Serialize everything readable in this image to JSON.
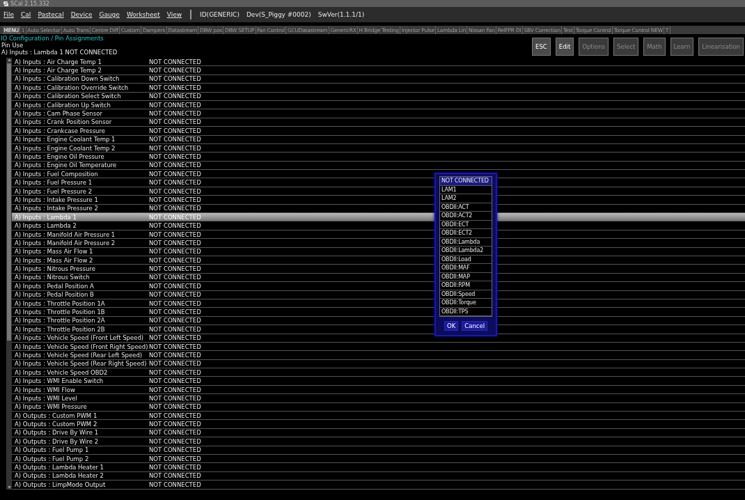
{
  "window": {
    "title": "SCal 2.15.332"
  },
  "menu": [
    {
      "label": "File"
    },
    {
      "label": "Cal"
    },
    {
      "label": "Pastecal"
    },
    {
      "label": "Device"
    },
    {
      "label": "Gauge"
    },
    {
      "label": "Worksheet"
    },
    {
      "label": "View"
    }
  ],
  "device_info": [
    "ID(GENERIC)",
    "Dev(S_Piggy #0002)",
    "SwVer(1.1.1/1)"
  ],
  "tabs": [
    {
      "label": "MENU",
      "selected": true
    },
    {
      "label": "1",
      "selected": false
    },
    {
      "label": "Auto Selector",
      "selected": false
    },
    {
      "label": "Auto Trans",
      "selected": false
    },
    {
      "label": "Centre Diff",
      "selected": false
    },
    {
      "label": "Custom",
      "selected": false
    },
    {
      "label": "Dampers",
      "selected": false
    },
    {
      "label": "Datastream",
      "selected": false
    },
    {
      "label": "DBW pos",
      "selected": false
    },
    {
      "label": "DBW SETUP",
      "selected": false
    },
    {
      "label": "Fan Control",
      "selected": false
    },
    {
      "label": "GCUDatastream",
      "selected": false
    },
    {
      "label": "GenericRX",
      "selected": false
    },
    {
      "label": "H Bridge Testing",
      "selected": false
    },
    {
      "label": "Injector Pulse",
      "selected": false
    },
    {
      "label": "Lambda Lin",
      "selected": false
    },
    {
      "label": "Nissan Fan",
      "selected": false
    },
    {
      "label": "RelFPR DI",
      "selected": false
    },
    {
      "label": "SBV Correction",
      "selected": false
    },
    {
      "label": "Test",
      "selected": false
    },
    {
      "label": "Torque Control",
      "selected": false
    },
    {
      "label": "Torque Control NEW",
      "selected": false
    },
    {
      "label": "T",
      "selected": false
    }
  ],
  "page_title": "IO Configuration / Pin Assignments",
  "header": {
    "label": "Pin Use",
    "current": "A) Inputs : Lambda 1  NOT CONNECTED"
  },
  "actions": [
    {
      "label": "ESC",
      "disabled": false
    },
    {
      "label": "Edit",
      "disabled": false
    },
    {
      "label": "Options",
      "disabled": true
    },
    {
      "label": "Select",
      "disabled": true
    },
    {
      "label": "Math",
      "disabled": true
    },
    {
      "label": "Learn",
      "disabled": true
    },
    {
      "label": "Linearisation",
      "disabled": true
    }
  ],
  "rows": [
    {
      "name": "A) Inputs : Air Charge Temp 1",
      "value": "NOT CONNECTED",
      "selected": false
    },
    {
      "name": "A) Inputs : Air Charge Temp 2",
      "value": "NOT CONNECTED",
      "selected": false
    },
    {
      "name": "A) Inputs : Calibration Down Switch",
      "value": "NOT CONNECTED",
      "selected": false
    },
    {
      "name": "A) Inputs : Calibration Override Switch",
      "value": "NOT CONNECTED",
      "selected": false
    },
    {
      "name": "A) Inputs : Calibration Select Switch",
      "value": "NOT CONNECTED",
      "selected": false
    },
    {
      "name": "A) Inputs : Calibration Up Switch",
      "value": "NOT CONNECTED",
      "selected": false
    },
    {
      "name": "A) Inputs : Cam Phase Sensor",
      "value": "NOT CONNECTED",
      "selected": false
    },
    {
      "name": "A) Inputs : Crank Position Sensor",
      "value": "NOT CONNECTED",
      "selected": false
    },
    {
      "name": "A) Inputs : Crankcase Pressure",
      "value": "NOT CONNECTED",
      "selected": false
    },
    {
      "name": "A) Inputs : Engine Coolant Temp 1",
      "value": "NOT CONNECTED",
      "selected": false
    },
    {
      "name": "A) Inputs : Engine Coolant Temp 2",
      "value": "NOT CONNECTED",
      "selected": false
    },
    {
      "name": "A) Inputs : Engine Oil Pressure",
      "value": "NOT CONNECTED",
      "selected": false
    },
    {
      "name": "A) Inputs : Engine Oil Temperature",
      "value": "NOT CONNECTED",
      "selected": false
    },
    {
      "name": "A) Inputs : Fuel Composition",
      "value": "NOT CONNECTED",
      "selected": false
    },
    {
      "name": "A) Inputs : Fuel Pressure 1",
      "value": "NOT CONNECTED",
      "selected": false
    },
    {
      "name": "A) Inputs : Fuel Pressure 2",
      "value": "NOT CONNECTED",
      "selected": false
    },
    {
      "name": "A) Inputs : Intake Pressure 1",
      "value": "NOT CONNECTED",
      "selected": false
    },
    {
      "name": "A) Inputs : Intake Pressure 2",
      "value": "NOT CONNECTED",
      "selected": false
    },
    {
      "name": "A) Inputs : Lambda 1",
      "value": "NOT CONNECTED",
      "selected": true
    },
    {
      "name": "A) Inputs : Lambda 2",
      "value": "NOT CONNECTED",
      "selected": false
    },
    {
      "name": "A) Inputs : Manifold Air Pressure 1",
      "value": "NOT CONNECTED",
      "selected": false
    },
    {
      "name": "A) Inputs : Manifold Air Pressure 2",
      "value": "NOT CONNECTED",
      "selected": false
    },
    {
      "name": "A) Inputs : Mass Air Flow 1",
      "value": "NOT CONNECTED",
      "selected": false
    },
    {
      "name": "A) Inputs : Mass Air Flow 2",
      "value": "NOT CONNECTED",
      "selected": false
    },
    {
      "name": "A) Inputs : Nitrous Pressure",
      "value": "NOT CONNECTED",
      "selected": false
    },
    {
      "name": "A) Inputs : Nitrous Switch",
      "value": "NOT CONNECTED",
      "selected": false
    },
    {
      "name": "A) Inputs : Pedal Position A",
      "value": "NOT CONNECTED",
      "selected": false
    },
    {
      "name": "A) Inputs : Pedal Position B",
      "value": "NOT CONNECTED",
      "selected": false
    },
    {
      "name": "A) Inputs : Throttle Position 1A",
      "value": "NOT CONNECTED",
      "selected": false
    },
    {
      "name": "A) Inputs : Throttle Position 1B",
      "value": "NOT CONNECTED",
      "selected": false
    },
    {
      "name": "A) Inputs : Throttle Position 2A",
      "value": "NOT CONNECTED",
      "selected": false
    },
    {
      "name": "A) Inputs : Throttle Position 2B",
      "value": "NOT CONNECTED",
      "selected": false
    },
    {
      "name": "A) Inputs : Vehicle Speed (Front Left Speed)",
      "value": "NOT CONNECTED",
      "selected": false
    },
    {
      "name": "A) Inputs : Vehicle Speed (Front Right Speed)",
      "value": "NOT CONNECTED",
      "selected": false
    },
    {
      "name": "A) Inputs : Vehicle Speed (Rear Left Speed)",
      "value": "NOT CONNECTED",
      "selected": false
    },
    {
      "name": "A) Inputs : Vehicle Speed (Rear Right Speed)",
      "value": "NOT CONNECTED",
      "selected": false
    },
    {
      "name": "A) Inputs : Vehicle Speed OBD2",
      "value": "NOT CONNECTED",
      "selected": false
    },
    {
      "name": "A) Inputs : WMI Enable Switch",
      "value": "NOT CONNECTED",
      "selected": false
    },
    {
      "name": "A) Inputs : WMI Flow",
      "value": "NOT CONNECTED",
      "selected": false
    },
    {
      "name": "A) Inputs : WMI Level",
      "value": "NOT CONNECTED",
      "selected": false
    },
    {
      "name": "A) Inputs : WMI Pressure",
      "value": "NOT CONNECTED",
      "selected": false
    },
    {
      "name": "A) Outputs : Custom PWM 1",
      "value": "NOT CONNECTED",
      "selected": false
    },
    {
      "name": "A) Outputs : Custom PWM 2",
      "value": "NOT CONNECTED",
      "selected": false
    },
    {
      "name": "A) Outputs : Drive By Wire 1",
      "value": "NOT CONNECTED",
      "selected": false
    },
    {
      "name": "A) Outputs : Drive By Wire 2",
      "value": "NOT CONNECTED",
      "selected": false
    },
    {
      "name": "A) Outputs : Fuel Pump 1",
      "value": "NOT CONNECTED",
      "selected": false
    },
    {
      "name": "A) Outputs : Fuel Pump 2",
      "value": "NOT CONNECTED",
      "selected": false
    },
    {
      "name": "A) Outputs : Lambda Heater 1",
      "value": "NOT CONNECTED",
      "selected": false
    },
    {
      "name": "A) Outputs : Lambda Heater 2",
      "value": "NOT CONNECTED",
      "selected": false
    },
    {
      "name": "A) Outputs : LimpMode Output",
      "value": "NOT CONNECTED",
      "selected": false
    }
  ],
  "picker": {
    "options": [
      {
        "label": "NOT CONNECTED",
        "selected": true
      },
      {
        "label": "LAM1",
        "selected": false
      },
      {
        "label": "LAM2",
        "selected": false
      },
      {
        "label": "OBDII:ACT",
        "selected": false
      },
      {
        "label": "OBDII:ACT2",
        "selected": false
      },
      {
        "label": "OBDII:ECT",
        "selected": false
      },
      {
        "label": "OBDII:ECT2",
        "selected": false
      },
      {
        "label": "OBDII:Lambda",
        "selected": false
      },
      {
        "label": "OBDII:Lambda2",
        "selected": false
      },
      {
        "label": "OBDII:Load",
        "selected": false
      },
      {
        "label": "OBDII:MAF",
        "selected": false
      },
      {
        "label": "OBDII:MAP",
        "selected": false
      },
      {
        "label": "OBDII:RPM",
        "selected": false
      },
      {
        "label": "OBDII:Speed",
        "selected": false
      },
      {
        "label": "OBDII:Torque",
        "selected": false
      },
      {
        "label": "OBDII:TPS",
        "selected": false
      }
    ],
    "buttons": [
      "OK",
      "Cancel"
    ]
  }
}
